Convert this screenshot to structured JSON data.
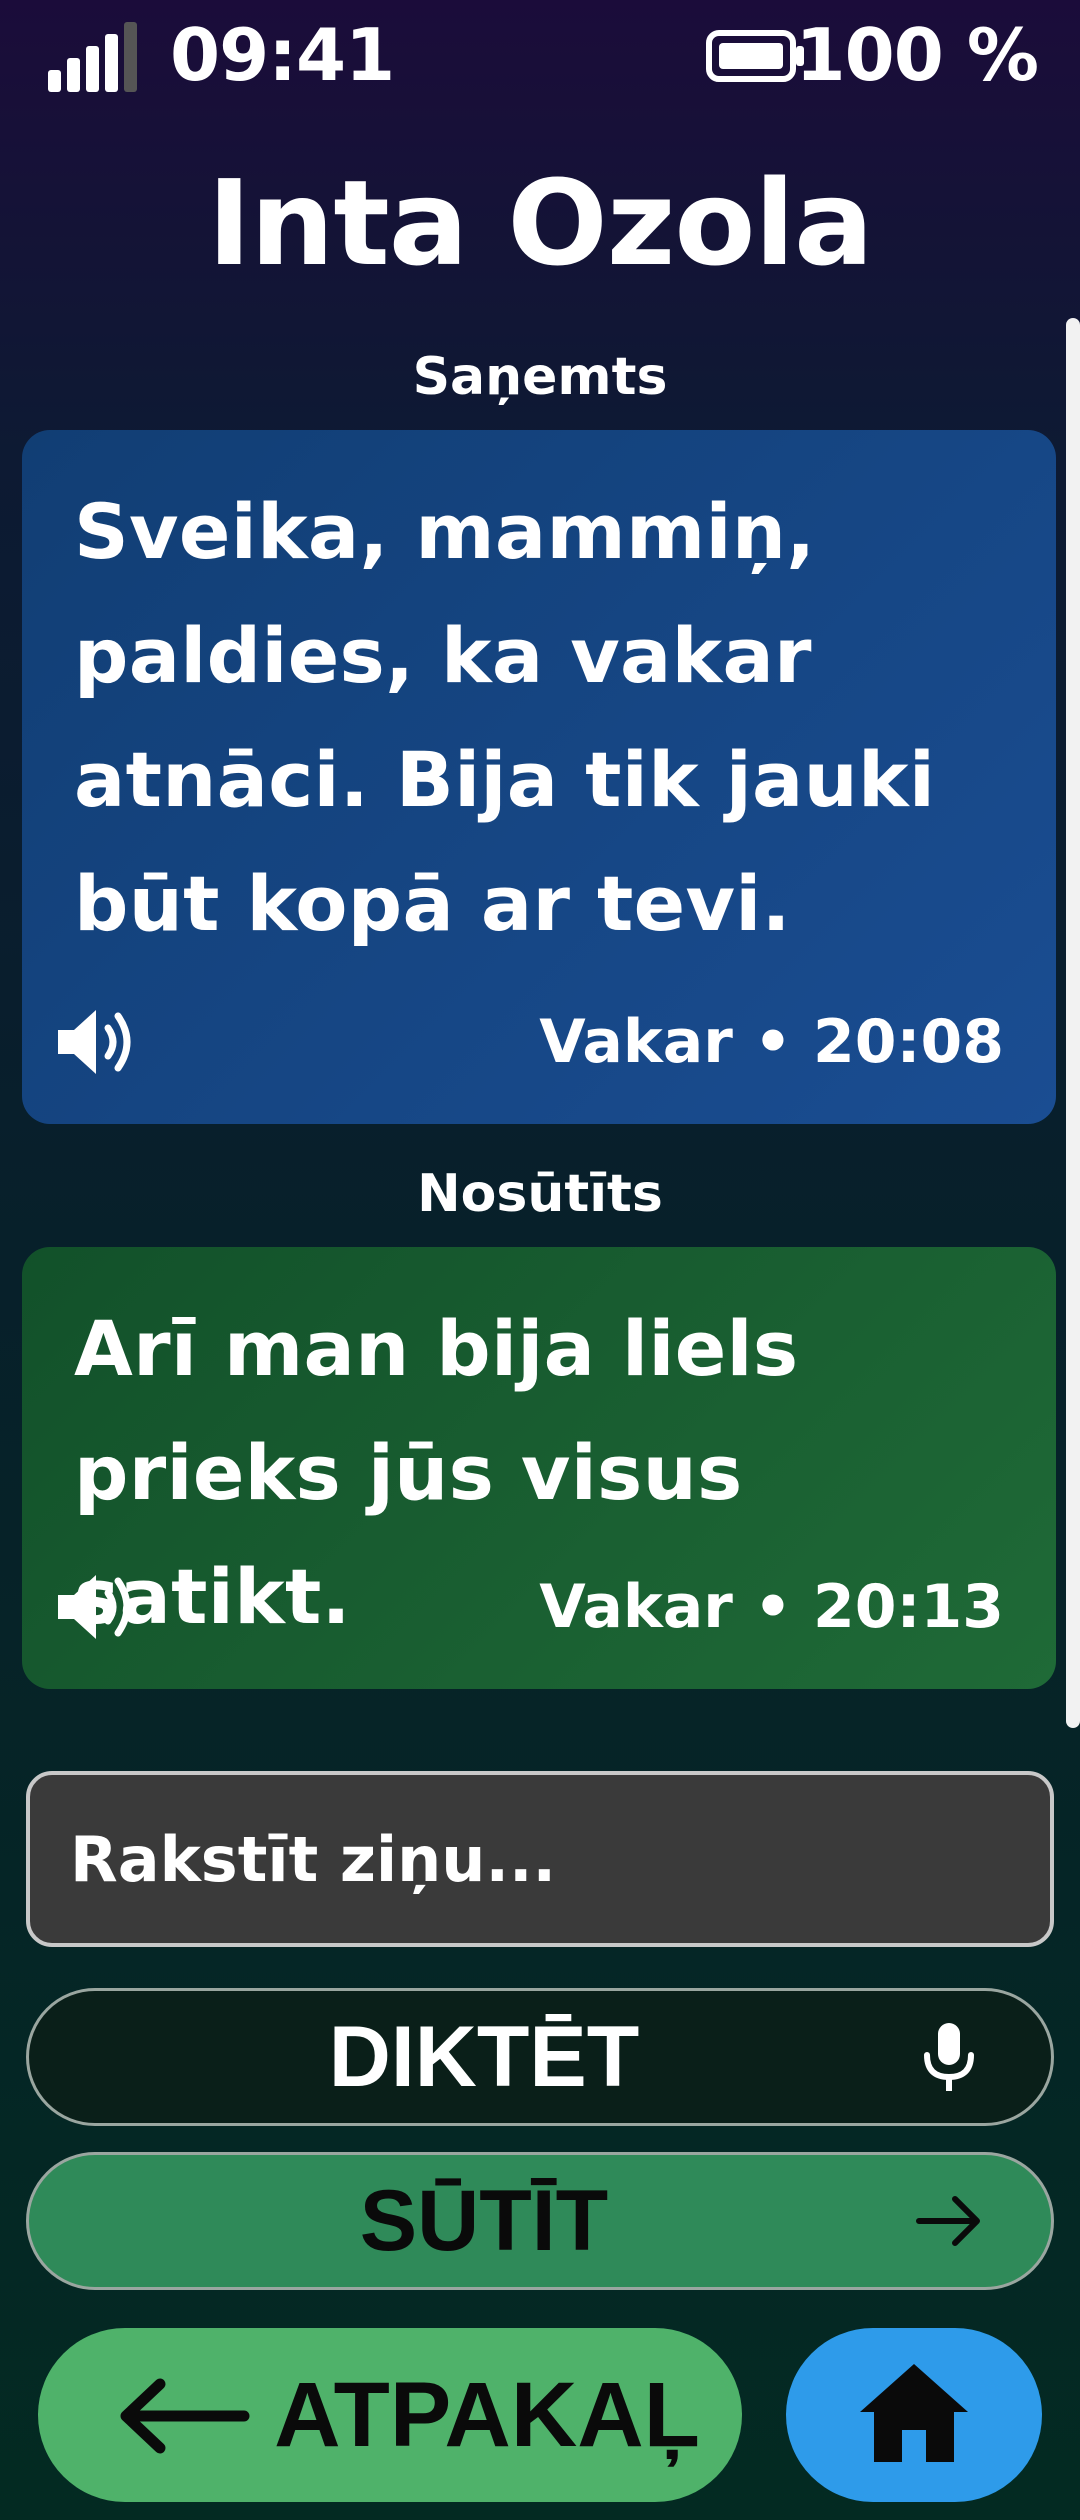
{
  "status_bar": {
    "time": "09:41",
    "battery": "100 %",
    "icons": [
      "signal-icon",
      "battery-icon"
    ]
  },
  "header": {
    "contact_name": "Inta Ozola"
  },
  "messages": [
    {
      "direction_label": "Saņemts",
      "text": "Sveika, mammiņ, paldies, ka vakar atnāci. Bija tik jauki būt kopā ar tevi.",
      "timestamp": "Vakar • 20:08",
      "icon": "speaker-icon",
      "color": "#1a4d92"
    },
    {
      "direction_label": "Nosūtīts",
      "text": "Arī man bija liels prieks jūs visus satikt.",
      "timestamp": "Vakar • 20:13",
      "icon": "speaker-icon",
      "color": "#1f6a37"
    }
  ],
  "composer": {
    "placeholder": "Rakstīt ziņu..."
  },
  "actions": {
    "dictate_label": "DIKTĒT",
    "dictate_icon": "microphone-icon",
    "send_label": "SŪTĪT",
    "send_icon": "arrow-right-icon"
  },
  "navigation": {
    "back_label": "ATPAKAĻ",
    "back_icon": "arrow-left-icon",
    "home_icon": "home-icon"
  },
  "colors": {
    "received_bubble": "#1a4d92",
    "sent_bubble": "#1f6a37",
    "send_button": "#2f8a59",
    "back_button": "#4fb26a",
    "home_button": "#2e9bea"
  }
}
